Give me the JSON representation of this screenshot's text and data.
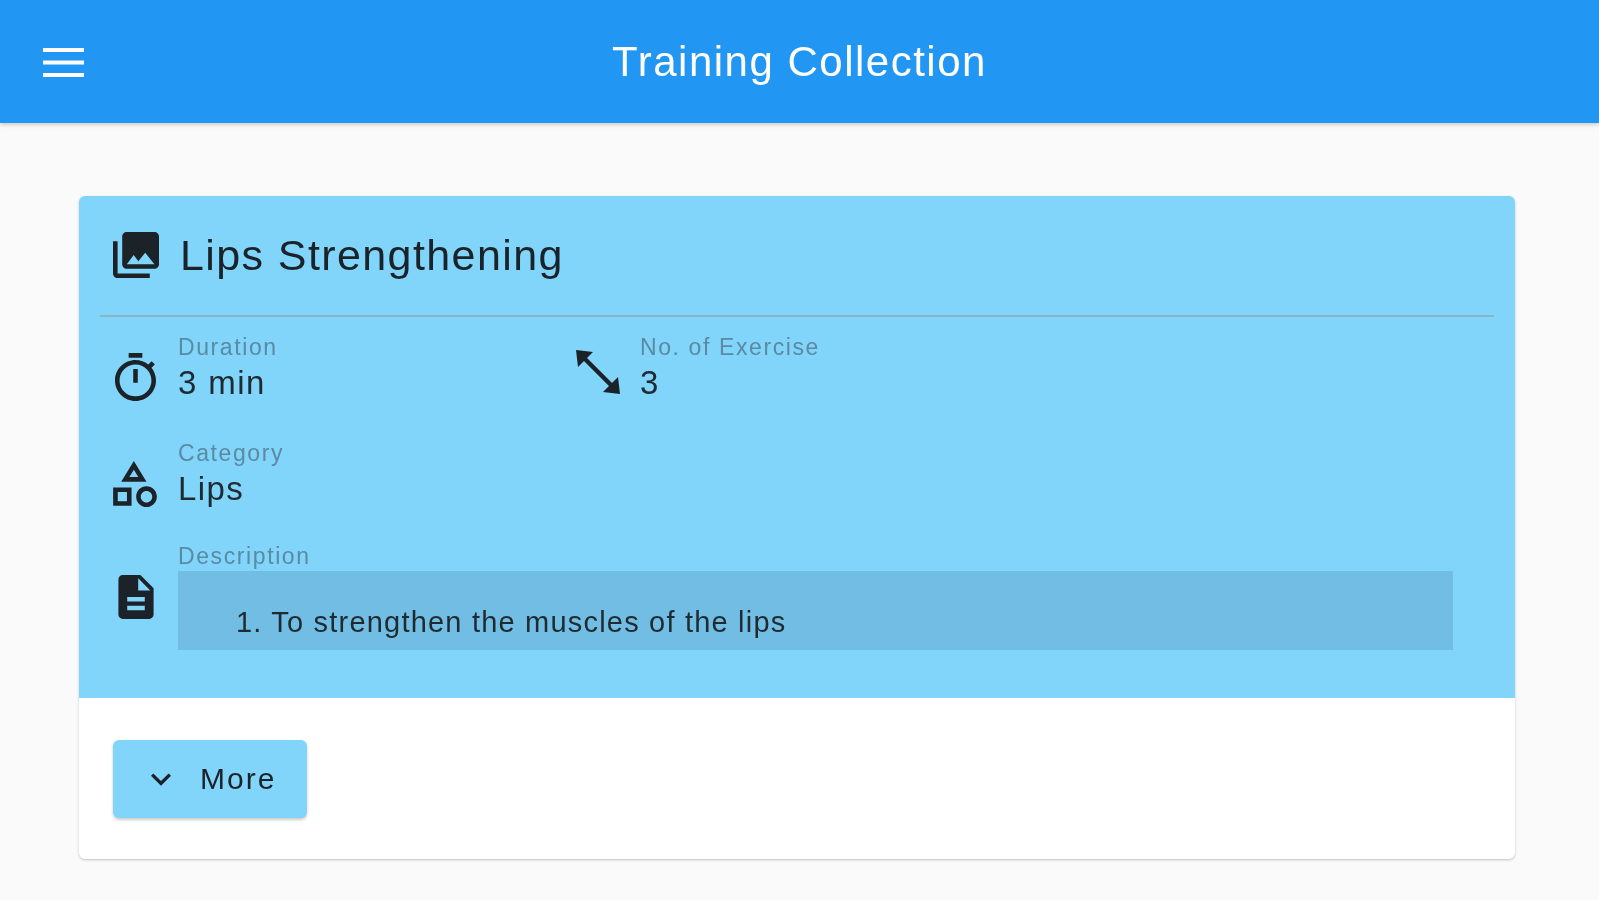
{
  "app_bar": {
    "title": "Training Collection"
  },
  "training_card": {
    "title": "Lips Strengthening",
    "duration": {
      "label": "Duration",
      "value": "3 min"
    },
    "exercise_count": {
      "label": "No. of Exercise",
      "value": "3"
    },
    "category": {
      "label": "Category",
      "value": "Lips"
    },
    "description": {
      "label": "Description",
      "text": "1. To strengthen the muscles of the lips"
    },
    "more_button": {
      "label": "More"
    }
  }
}
